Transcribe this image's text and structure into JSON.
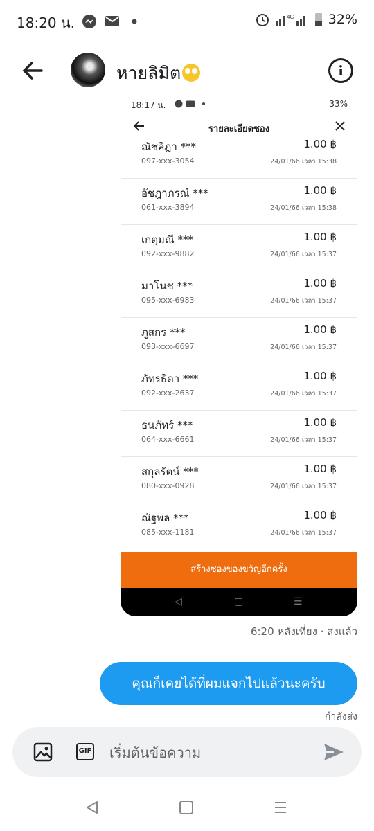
{
  "status_bar": {
    "time": "18:20 น.",
    "network": "4G",
    "battery": "32%",
    "icons": [
      "messenger-icon",
      "mail-icon",
      "dot-icon",
      "alarm-icon",
      "signal-icon",
      "battery-icon"
    ]
  },
  "header": {
    "contact_name": "หายลิมิต",
    "icons": [
      "back-arrow-icon",
      "avatar",
      "emoji-face-icon",
      "info-icon"
    ]
  },
  "screenshot": {
    "status_time": "18:17 น.",
    "battery": "33%",
    "title": "รายละเอียดซอง",
    "transactions": [
      {
        "name": "ณัชลิฎา ***",
        "amount": "1.00 ฿",
        "phone": "097-xxx-3054",
        "time": "24/01/66 เวลา 15:38"
      },
      {
        "name": "อัชฎาภรณ์ ***",
        "amount": "1.00 ฿",
        "phone": "061-xxx-3894",
        "time": "24/01/66 เวลา 15:38"
      },
      {
        "name": "เกตุมณี ***",
        "amount": "1.00 ฿",
        "phone": "092-xxx-9882",
        "time": "24/01/66 เวลา 15:37"
      },
      {
        "name": "มาโนช ***",
        "amount": "1.00 ฿",
        "phone": "095-xxx-6983",
        "time": "24/01/66 เวลา 15:37"
      },
      {
        "name": "ภูสกร ***",
        "amount": "1.00 ฿",
        "phone": "093-xxx-6697",
        "time": "24/01/66 เวลา 15:37"
      },
      {
        "name": "ภัทรธิดา ***",
        "amount": "1.00 ฿",
        "phone": "092-xxx-2637",
        "time": "24/01/66 เวลา 15:37"
      },
      {
        "name": "ธนภัทร์ ***",
        "amount": "1.00 ฿",
        "phone": "064-xxx-6661",
        "time": "24/01/66 เวลา 15:37"
      },
      {
        "name": "สกุลรัตน์ ***",
        "amount": "1.00 ฿",
        "phone": "080-xxx-0928",
        "time": "24/01/66 เวลา 15:37"
      },
      {
        "name": "ณัฐพล ***",
        "amount": "1.00 ฿",
        "phone": "085-xxx-1181",
        "time": "24/01/66 เวลา 15:37"
      }
    ],
    "create_button": "สร้างซองของขวัญอีกครั้ง",
    "button_color": "#ef6d0e"
  },
  "timestamp": "6:20 หลังเที่ยง · ส่งแล้ว",
  "sent_message": "คุณก็เคยได้ที่ผมแจกไปแล้วนะครับ",
  "sending_status": "กำลังส่ง",
  "composer": {
    "placeholder": "เริ่มต้นข้อความ",
    "gif_label": "GIF",
    "icons": [
      "image-icon",
      "gif-icon",
      "send-icon"
    ]
  },
  "colors": {
    "bubble": "#1d9bf0",
    "composer_bg": "#eff1f3"
  }
}
